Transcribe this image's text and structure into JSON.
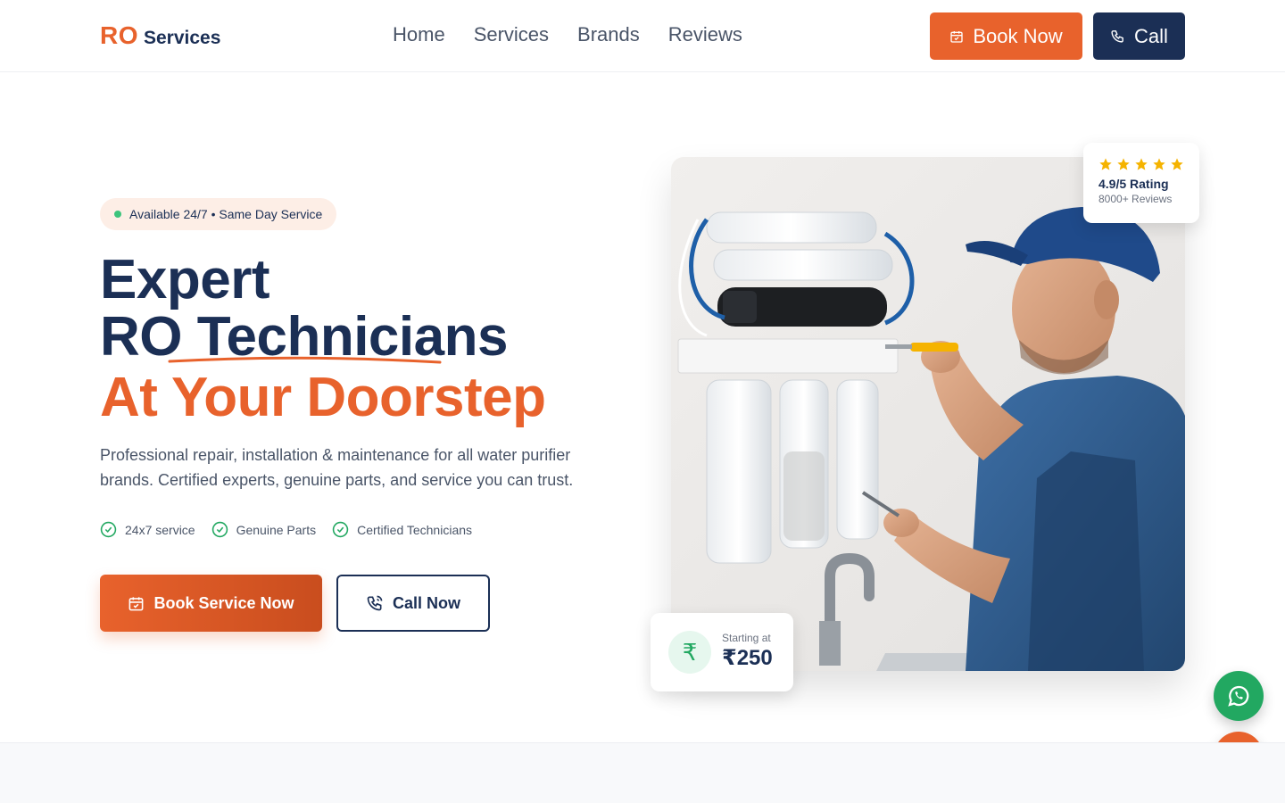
{
  "header": {
    "logo_ro": "RO",
    "logo_services": "Services",
    "nav": [
      "Home",
      "Services",
      "Brands",
      "Reviews"
    ],
    "book_now": "Book Now",
    "call": "Call"
  },
  "hero": {
    "badge": "Available 24/7 • Same Day Service",
    "title_line1": "Expert",
    "title_line2": "RO Technicians",
    "title_line3": "At Your Doorstep",
    "lede": "Professional repair, installation & maintenance for all water purifier brands. Certified experts, genuine parts, and service you can trust.",
    "features": [
      "24x7 service",
      "Genuine Parts",
      "Certified Technicians"
    ],
    "primary_cta": "Book Service Now",
    "secondary_cta": "Call Now"
  },
  "rating_card": {
    "stars": 5,
    "title": "4.9/5 Rating",
    "subtitle": "8000+ Reviews"
  },
  "price_card": {
    "icon": "₹",
    "label": "Starting at",
    "value": "₹250"
  },
  "colors": {
    "brand_orange": "#e8622c",
    "navy": "#1b2f55",
    "green": "#22a861",
    "star": "#f5b300"
  },
  "icons": {
    "book": "calendar-icon",
    "call": "phone-icon",
    "feature": "check-circle-icon",
    "whatsapp": "whatsapp-icon"
  }
}
